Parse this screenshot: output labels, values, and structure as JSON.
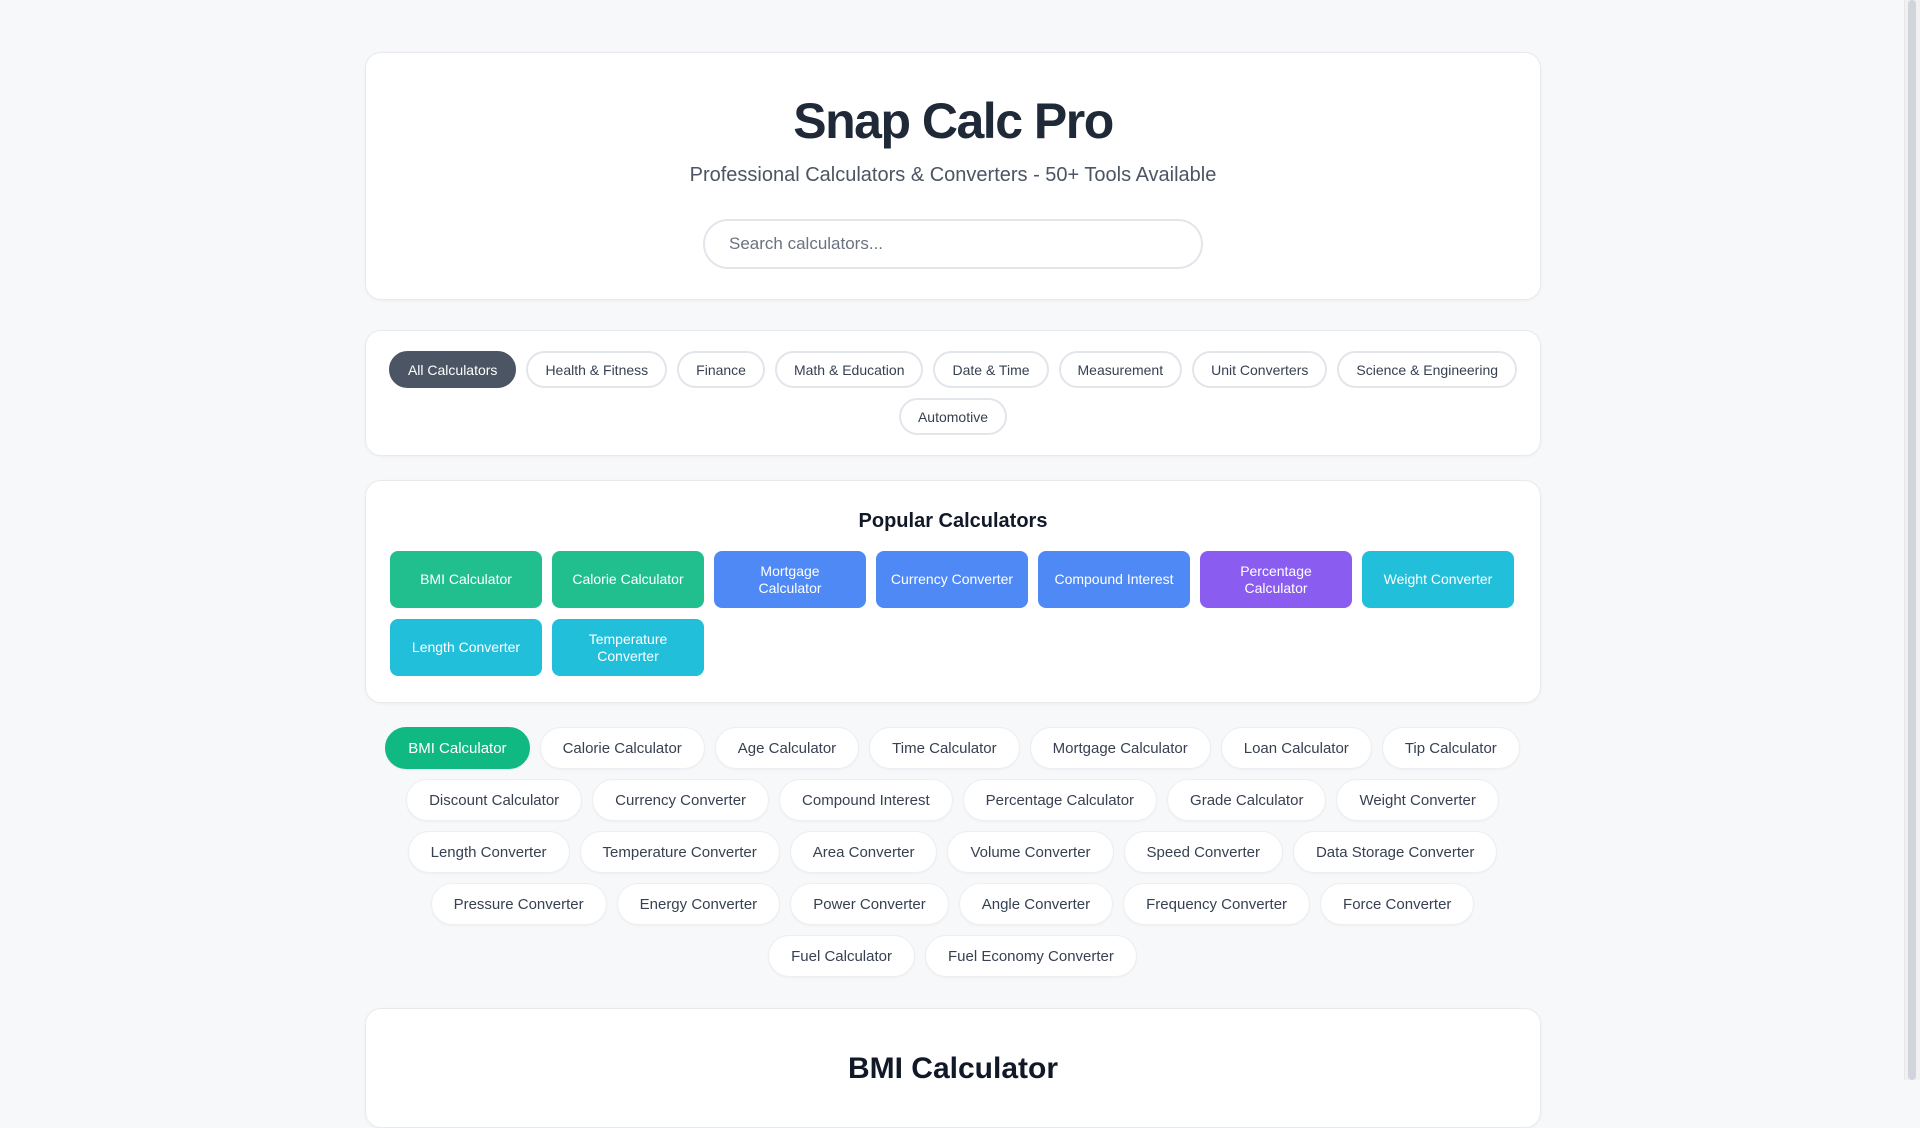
{
  "header": {
    "title": "Snap Calc Pro",
    "subtitle": "Professional Calculators & Converters - 50+ Tools Available",
    "search_placeholder": "Search calculators..."
  },
  "filters": [
    {
      "label": "All Calculators",
      "active": true
    },
    {
      "label": "Health & Fitness",
      "active": false
    },
    {
      "label": "Finance",
      "active": false
    },
    {
      "label": "Math & Education",
      "active": false
    },
    {
      "label": "Date & Time",
      "active": false
    },
    {
      "label": "Measurement",
      "active": false
    },
    {
      "label": "Unit Converters",
      "active": false
    },
    {
      "label": "Science & Engineering",
      "active": false
    },
    {
      "label": "Automotive",
      "active": false
    }
  ],
  "popular": {
    "title": "Popular Calculators",
    "items": [
      {
        "label": "BMI Calculator",
        "category": "health",
        "color": "#22bf8e"
      },
      {
        "label": "Calorie Calculator",
        "category": "health",
        "color": "#22bf8e"
      },
      {
        "label": "Mortgage Calculator",
        "category": "finance",
        "color": "#4f89f5"
      },
      {
        "label": "Currency Converter",
        "category": "finance",
        "color": "#4f89f5"
      },
      {
        "label": "Compound Interest",
        "category": "finance",
        "color": "#4f89f5"
      },
      {
        "label": "Percentage Calculator",
        "category": "math",
        "color": "#8a5cf0"
      },
      {
        "label": "Weight Converter",
        "category": "convert",
        "color": "#21bfd9"
      },
      {
        "label": "Length Converter",
        "category": "convert",
        "color": "#21bfd9"
      },
      {
        "label": "Temperature Converter",
        "category": "convert",
        "color": "#21bfd9"
      }
    ]
  },
  "calculators": [
    {
      "label": "BMI Calculator",
      "active": true
    },
    {
      "label": "Calorie Calculator",
      "active": false
    },
    {
      "label": "Age Calculator",
      "active": false
    },
    {
      "label": "Time Calculator",
      "active": false
    },
    {
      "label": "Mortgage Calculator",
      "active": false
    },
    {
      "label": "Loan Calculator",
      "active": false
    },
    {
      "label": "Tip Calculator",
      "active": false
    },
    {
      "label": "Discount Calculator",
      "active": false
    },
    {
      "label": "Currency Converter",
      "active": false
    },
    {
      "label": "Compound Interest",
      "active": false
    },
    {
      "label": "Percentage Calculator",
      "active": false
    },
    {
      "label": "Grade Calculator",
      "active": false
    },
    {
      "label": "Weight Converter",
      "active": false
    },
    {
      "label": "Length Converter",
      "active": false
    },
    {
      "label": "Temperature Converter",
      "active": false
    },
    {
      "label": "Area Converter",
      "active": false
    },
    {
      "label": "Volume Converter",
      "active": false
    },
    {
      "label": "Speed Converter",
      "active": false
    },
    {
      "label": "Data Storage Converter",
      "active": false
    },
    {
      "label": "Pressure Converter",
      "active": false
    },
    {
      "label": "Energy Converter",
      "active": false
    },
    {
      "label": "Power Converter",
      "active": false
    },
    {
      "label": "Angle Converter",
      "active": false
    },
    {
      "label": "Frequency Converter",
      "active": false
    },
    {
      "label": "Force Converter",
      "active": false
    },
    {
      "label": "Fuel Calculator",
      "active": false
    },
    {
      "label": "Fuel Economy Converter",
      "active": false
    }
  ],
  "active_calculator": {
    "title": "BMI Calculator"
  },
  "colors": {
    "accent_active": "#10b981",
    "filter_active": "#4b5563"
  }
}
